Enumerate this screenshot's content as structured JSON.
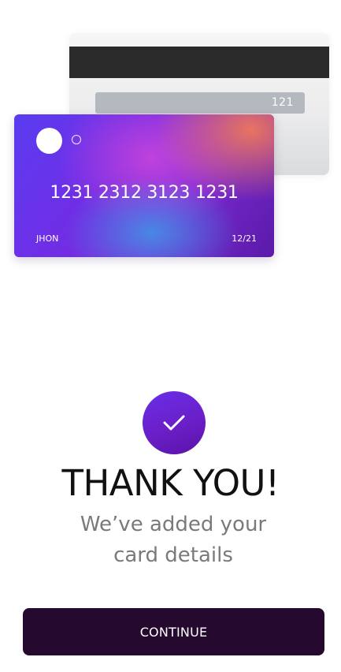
{
  "card_back": {
    "cvv": "121"
  },
  "card_front": {
    "number": "1231 2312 3123 1231",
    "holder": "JHON",
    "expiry": "12/21"
  },
  "confirmation": {
    "title": "THANK YOU!",
    "subtitle": "We’ve added your card details",
    "icon": "check-icon"
  },
  "actions": {
    "continue_label": "CONTINUE"
  },
  "colors": {
    "accent": "#6a2ee8",
    "button": "#25092f",
    "subtitle": "#7a7a7a"
  }
}
